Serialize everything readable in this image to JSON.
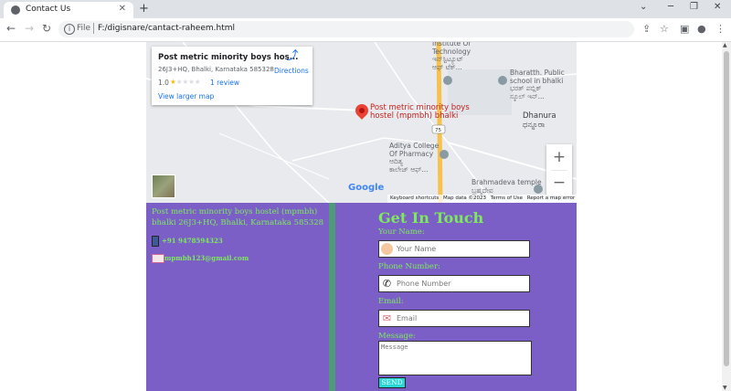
{
  "browser": {
    "tab_title": "Contact Us",
    "tab_close": "✕",
    "new_tab": "+",
    "window_controls": [
      "⌄",
      "─",
      "❐",
      "✕"
    ],
    "nav": {
      "back": "←",
      "forward": "→",
      "reload": "↻"
    },
    "info_icon": "i",
    "url_scheme": "File",
    "url": "F:/digisnare/cantact-raheem.html",
    "toolbar_icons": [
      "share-icon",
      "star-icon",
      "sidebar-icon",
      "profile-icon",
      "menu-icon"
    ],
    "toolbar_glyphs": [
      "⇪",
      "☆",
      "▣",
      "●",
      "⋮"
    ]
  },
  "map": {
    "card": {
      "place_name": "Post metric minority boys hos...",
      "address": "26J3+HQ, Bhalki, Karnataka 585328",
      "rating": "1.0",
      "stars_filled": "★",
      "stars_empty": "★★★★",
      "reviews": "1 review",
      "larger_map": "View larger map",
      "directions_icon": "⤴",
      "directions": "Directions"
    },
    "pin_label": "Post metric minority boys\nhostel (mpmbh) bhalki",
    "labels": {
      "institute": "Institute Of\nTechnology\nಇನ್‌ಸ್ಟಿಟ್ಯೂಟ್\nಆಫ್ ಟೆಕ್...",
      "bharath": "Bharatth. Public\nschool in bhalki\nಭರತ್ ಪಬ್ಲಿಕ್\nಸ್ಕೂಲ್ ಇನ್...",
      "dhanura": "Dhanura\nಧನ್ನೂರಾ",
      "aditya": "Aditya College\nOf Pharmacy\nಆದಿತ್ಯ\nಕಾಲೇಜ್ ಆಫ್...",
      "brahmadeva": "Brahmadeva temple\nಬ್ರಹ್ಮದೇವ",
      "road": "75"
    },
    "zoom_in": "+",
    "zoom_out": "−",
    "google_logo": "Google",
    "footer": [
      "Keyboard shortcuts",
      "Map data ©2023",
      "Terms of Use",
      "Report a map error"
    ],
    "colors": {
      "pin": "#ea4335",
      "link": "#1a73e8",
      "road": "#f6c24d"
    }
  },
  "contact": {
    "address": "Post metric minority boys hostel (mpmbh) bhalki 26J3+HQ, Bhalki, Karnataka 585328",
    "phone": "+91 9478594323",
    "email": "mpmbh123@gmail.com"
  },
  "form": {
    "heading": "Get In Touch",
    "name_label": "Your Name:",
    "name_placeholder": "Your Name",
    "phone_label": "Phone Number:",
    "phone_placeholder": "Phone Number",
    "email_label": "Email:",
    "email_placeholder": "Email",
    "message_label": "Message:",
    "message_placeholder": "Message",
    "send": "SEND"
  },
  "theme": {
    "panel": "#7b5fc7",
    "divider": "#4f9a7a",
    "text": "#7dea5c",
    "send_button": "#28d6d6"
  }
}
